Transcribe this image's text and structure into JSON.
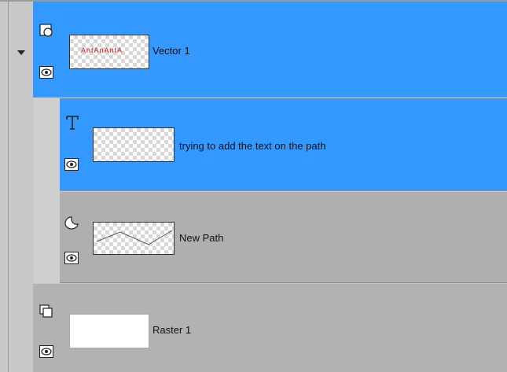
{
  "layers": [
    {
      "name": "Vector 1",
      "type_icon": "vector-layer-icon",
      "selected": true,
      "thumb": "vector-text-thumbnail"
    },
    {
      "name": "trying to add the text on the path",
      "type_icon": "text-layer-icon",
      "selected": true,
      "thumb": "transparent-thumbnail"
    },
    {
      "name": "New Path",
      "type_icon": "path-layer-icon",
      "selected": false,
      "thumb": "path-curve-thumbnail"
    },
    {
      "name": "Raster 1",
      "type_icon": "raster-layer-icon",
      "selected": false,
      "thumb": "white-thumbnail"
    }
  ],
  "thumbnail_text": "AnfAnAnfA",
  "colors": {
    "selected": "#3399ff",
    "normal": "#afafaf",
    "background": "#c8c8c8"
  }
}
